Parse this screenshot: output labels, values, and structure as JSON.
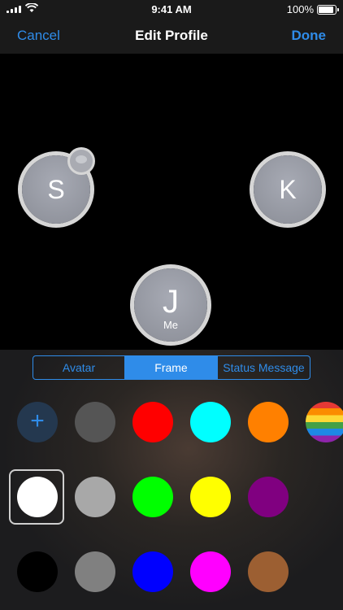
{
  "status_bar": {
    "time": "9:41 AM",
    "battery": "100%",
    "battery_fill": 1.0
  },
  "nav": {
    "cancel": "Cancel",
    "title": "Edit Profile",
    "done": "Done"
  },
  "avatars": {
    "left": "S",
    "right": "K",
    "me_initial": "J",
    "me_label": "Me"
  },
  "segments": [
    "Avatar",
    "Frame",
    "Status Message"
  ],
  "selected_segment": "Frame",
  "frame_colors": [
    [
      "add",
      "#555555",
      "#ff0000",
      "#00ffff",
      "#ff8000",
      "rainbow"
    ],
    [
      "#ffffff",
      "#a8a8a8",
      "#00ff00",
      "#ffff00",
      "#800080"
    ],
    [
      "#000000",
      "#808080",
      "#0000ff",
      "#ff00ff",
      "#9c5f32"
    ]
  ],
  "selected_frame_color": "#ffffff"
}
